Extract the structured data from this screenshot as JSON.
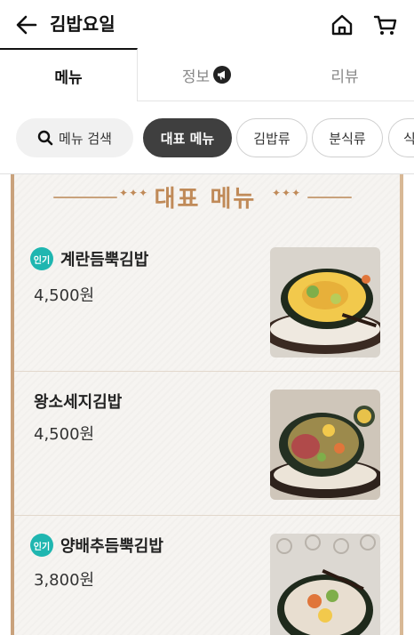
{
  "header": {
    "title": "김밥요일",
    "back_icon": "arrow-left-icon",
    "home_icon": "home-icon",
    "cart_icon": "cart-icon"
  },
  "tabs": [
    {
      "label": "메뉴",
      "active": true
    },
    {
      "label": "정보",
      "active": false,
      "icon": "megaphone-icon"
    },
    {
      "label": "리뷰",
      "active": false
    }
  ],
  "filters": {
    "search_label": "메뉴 검색",
    "chips": [
      "대표 메뉴",
      "김밥류",
      "분식류",
      "식"
    ]
  },
  "section": {
    "title": "대표 메뉴"
  },
  "items": [
    {
      "name": "계란듬뿍김밥",
      "price": "4,500원",
      "popular": true,
      "badge": "인기"
    },
    {
      "name": "왕소세지김밥",
      "price": "4,500원",
      "popular": false
    },
    {
      "name": "양배추듬뿍김밥",
      "price": "3,800원",
      "popular": true,
      "badge": "인기"
    }
  ],
  "colors": {
    "accent": "#c08a58",
    "badge": "#1fb6b0",
    "active_chip": "#3f3f3f"
  }
}
